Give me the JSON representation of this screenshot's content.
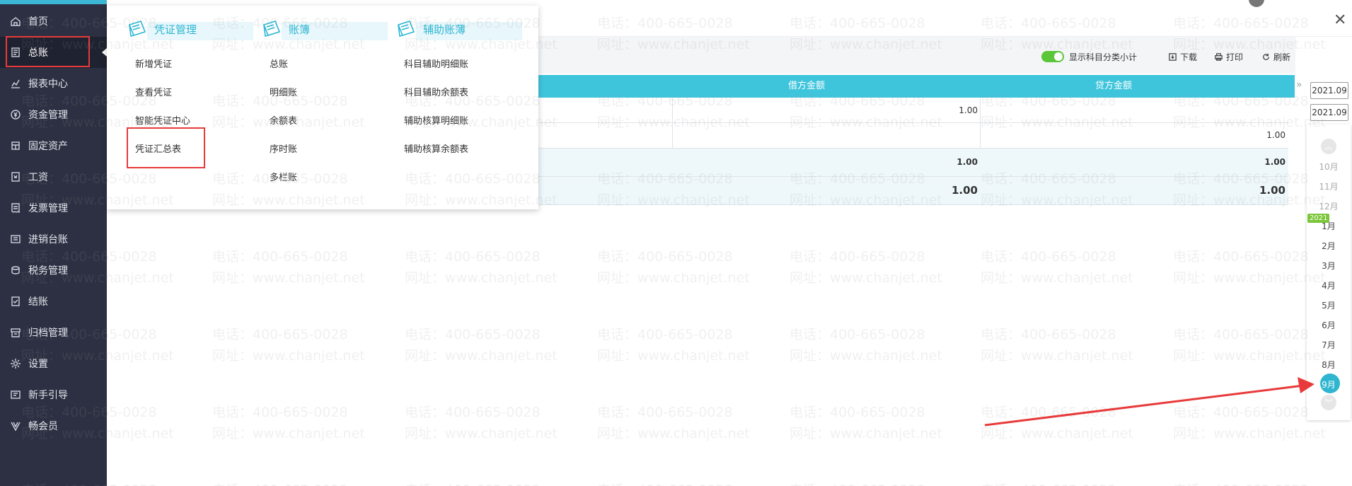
{
  "sidebar": {
    "items": [
      {
        "label": "首页",
        "icon": "home-icon"
      },
      {
        "label": "总账",
        "icon": "ledger-icon"
      },
      {
        "label": "报表中心",
        "icon": "chart-icon"
      },
      {
        "label": "资金管理",
        "icon": "money-icon"
      },
      {
        "label": "固定资产",
        "icon": "asset-icon"
      },
      {
        "label": "工资",
        "icon": "salary-icon"
      },
      {
        "label": "发票管理",
        "icon": "invoice-icon"
      },
      {
        "label": "进销台账",
        "icon": "inventory-icon"
      },
      {
        "label": "税务管理",
        "icon": "tax-icon"
      },
      {
        "label": "结账",
        "icon": "checkout-icon"
      },
      {
        "label": "归档管理",
        "icon": "archive-icon"
      },
      {
        "label": "设置",
        "icon": "gear-icon"
      },
      {
        "label": "新手引导",
        "icon": "guide-icon"
      },
      {
        "label": "畅会员",
        "icon": "vip-icon"
      }
    ],
    "active_index": 1
  },
  "menu": {
    "columns": [
      {
        "title": "凭证管理",
        "items": [
          "新增凭证",
          "查看凭证",
          "智能凭证中心",
          "凭证汇总表"
        ]
      },
      {
        "title": "账簿",
        "items": [
          "总账",
          "明细账",
          "余额表",
          "序时账",
          "多栏账"
        ]
      },
      {
        "title": "辅助账薄",
        "items": [
          "科目辅助明细账",
          "科目辅助余额表",
          "辅助核算明细账",
          "辅助核算余额表"
        ]
      }
    ]
  },
  "toolbar": {
    "toggle_label": "显示科目分类小计",
    "download_label": "下载",
    "print_label": "打印",
    "refresh_label": "刷新"
  },
  "table": {
    "headers": {
      "debit": "借方金额",
      "credit": "贷方金额"
    },
    "rows": [
      {
        "debit": "1.00",
        "credit": ""
      },
      {
        "debit": "",
        "credit": "1.00"
      },
      {
        "debit": "1.00",
        "credit": "1.00"
      },
      {
        "debit": "1.00",
        "credit": "1.00"
      }
    ]
  },
  "period": {
    "start": "2021.09",
    "end": "2021.09",
    "year_tag": "2021",
    "months": [
      "10月",
      "11月",
      "12月",
      "1月",
      "2月",
      "3月",
      "4月",
      "5月",
      "6月",
      "7月",
      "8月",
      "9月"
    ],
    "selected": "9月"
  },
  "watermark": {
    "phone": "电话：400-665-0028",
    "site": "网址：www.chanjet.net"
  },
  "colors": {
    "sidebar_bg": "#2c3042",
    "accent": "#3ec5dc",
    "annotation_red": "#e83a3a",
    "toggle_green": "#5cc63a"
  }
}
